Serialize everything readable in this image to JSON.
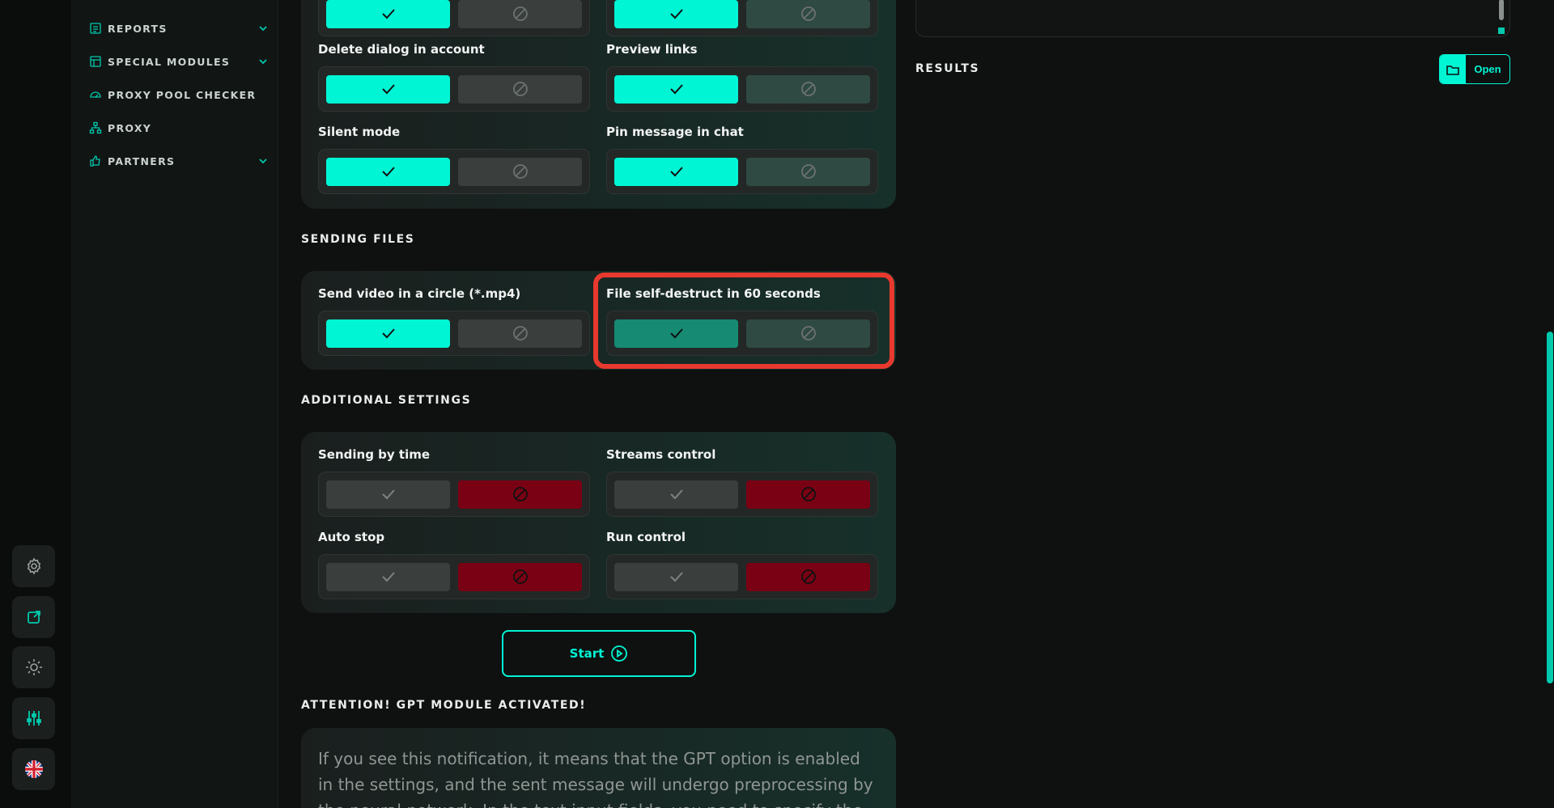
{
  "sidebar": {
    "items": [
      {
        "label": "REPORTS",
        "icon": "report-icon",
        "has_chevron": true
      },
      {
        "label": "SPECIAL MODULES",
        "icon": "modules-icon",
        "has_chevron": true
      },
      {
        "label": "PROXY POOL CHECKER",
        "icon": "gauge-icon",
        "has_chevron": false
      },
      {
        "label": "PROXY",
        "icon": "network-icon",
        "has_chevron": false
      },
      {
        "label": "PARTNERS",
        "icon": "thumbs-up-icon",
        "has_chevron": true
      }
    ]
  },
  "rail": {
    "buttons": [
      "settings-icon",
      "external-link-icon",
      "theme-icon",
      "sliders-icon",
      "language-flag-icon"
    ],
    "accent": "#00f5d4"
  },
  "main": {
    "top_card": {
      "options": [
        {
          "label": "Delete dialog in account",
          "value": "on"
        },
        {
          "label": "Preview links",
          "value": "on"
        },
        {
          "label": "Silent mode",
          "value": "on"
        },
        {
          "label": "Pin message in chat",
          "value": "on"
        }
      ]
    },
    "sending_files": {
      "title": "SENDING FILES",
      "options": [
        {
          "label": "Send video in a circle (*.mp4)",
          "value": "on"
        },
        {
          "label": "File self-destruct in 60 seconds",
          "value": "on",
          "highlighted": true
        }
      ]
    },
    "additional": {
      "title": "ADDITIONAL SETTINGS",
      "options": [
        {
          "label": "Sending by time",
          "value": "off"
        },
        {
          "label": "Streams control",
          "value": "off"
        },
        {
          "label": "Auto stop",
          "value": "off"
        },
        {
          "label": "Run control",
          "value": "off"
        }
      ]
    },
    "start_label": "Start",
    "gpt": {
      "title": "ATTENTION! GPT MODULE ACTIVATED!",
      "text": "If you see this notification, it means that the GPT option is enabled in the settings, and the sent message will undergo preprocessing by the neural network. In the text input fields, you need to specify the task for"
    }
  },
  "right": {
    "results_title": "RESULTS",
    "open_label": "Open"
  },
  "colors": {
    "accent": "#00f5d4",
    "highlight": "#e8392f",
    "off_red": "#7a0014"
  }
}
